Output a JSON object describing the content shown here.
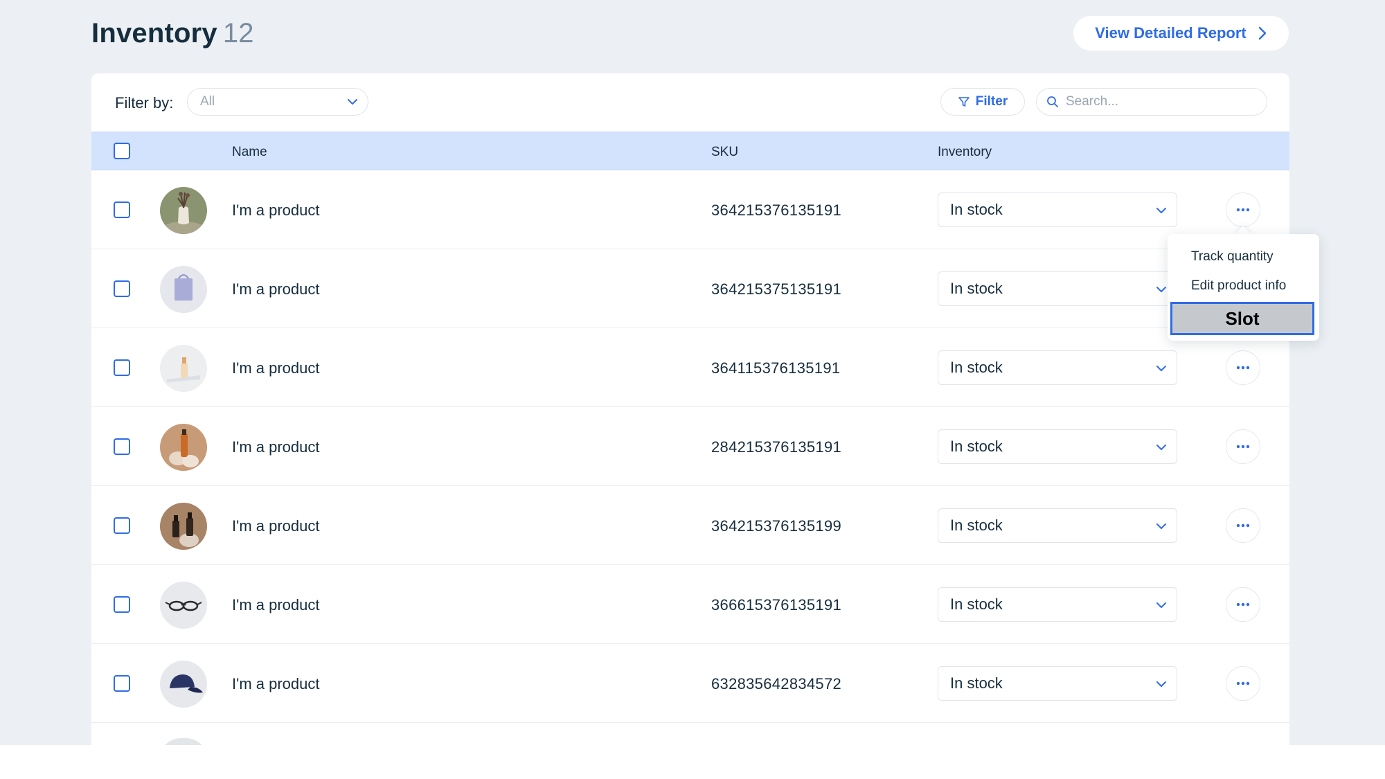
{
  "header": {
    "title": "Inventory",
    "count": "12",
    "report_button": "View Detailed Report"
  },
  "filter_bar": {
    "label": "Filter by:",
    "select_value": "All",
    "filter_button": "Filter",
    "search_placeholder": "Search..."
  },
  "columns": {
    "name": "Name",
    "sku": "SKU",
    "inventory": "Inventory"
  },
  "rows": [
    {
      "name": "I'm a product",
      "sku": "364215376135191",
      "inventory": "In stock",
      "thumb": "vase-with-dried-flowers"
    },
    {
      "name": "I'm a product",
      "sku": "364215375135191",
      "inventory": "In stock",
      "thumb": "lavender-tote-bag"
    },
    {
      "name": "I'm a product",
      "sku": "364115376135191",
      "inventory": "In stock",
      "thumb": "serum-bottle"
    },
    {
      "name": "I'm a product",
      "sku": "284215376135191",
      "inventory": "In stock",
      "thumb": "amber-bottle-with-stones"
    },
    {
      "name": "I'm a product",
      "sku": "364215376135199",
      "inventory": "In stock",
      "thumb": "two-dark-bottles"
    },
    {
      "name": "I'm a product",
      "sku": "366615376135191",
      "inventory": "In stock",
      "thumb": "eyeglasses"
    },
    {
      "name": "I'm a product",
      "sku": "632835642834572",
      "inventory": "In stock",
      "thumb": "navy-baseball-cap"
    }
  ],
  "context_menu": {
    "items": [
      "Track quantity",
      "Edit product info"
    ],
    "slot_label": "Slot"
  },
  "colors": {
    "accent": "#2f6ce5",
    "header_row": "#d3e3fd",
    "page_bg": "#ecf0f4",
    "text": "#162d3d"
  }
}
